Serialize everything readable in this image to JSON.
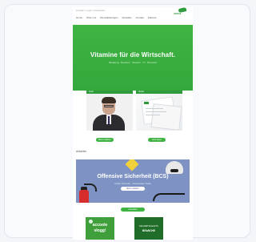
{
  "topbar": {
    "links": "Kontakt  |  Login  |  Newsletter",
    "logo_text": "VERIAS"
  },
  "nav": [
    "Home",
    "Über uns",
    "Dienstleistungen",
    "Aktuelles",
    "Kontakt",
    "Karriere"
  ],
  "hero": {
    "title": "Vitamine für die Wirtschaft.",
    "subtitle": "Beratung · Revision · Steuern · IT · Personal"
  },
  "cards": [
    {
      "header": "Team",
      "button": "Mehr erfahren"
    },
    {
      "header": "Studie",
      "button": "Jetzt lesen"
    }
  ],
  "section_label": "Aktuelles",
  "banner": {
    "title": "Offensive Sicherheit (BCS)",
    "subtitle": "Cyber Security · Penetration Tests",
    "button": "Mehr erfahren",
    "cta": "Anmelden"
  },
  "tiles": [
    {
      "line1": "accoole",
      "line2": "vlogg!"
    },
    {
      "line1": "DIE WIRTSCHAFTS",
      "line2": "BRANCHE"
    }
  ],
  "colors": {
    "brand_green": "#3fb443",
    "dark_green": "#1f6d28",
    "banner_blue": "#7e93c4"
  }
}
